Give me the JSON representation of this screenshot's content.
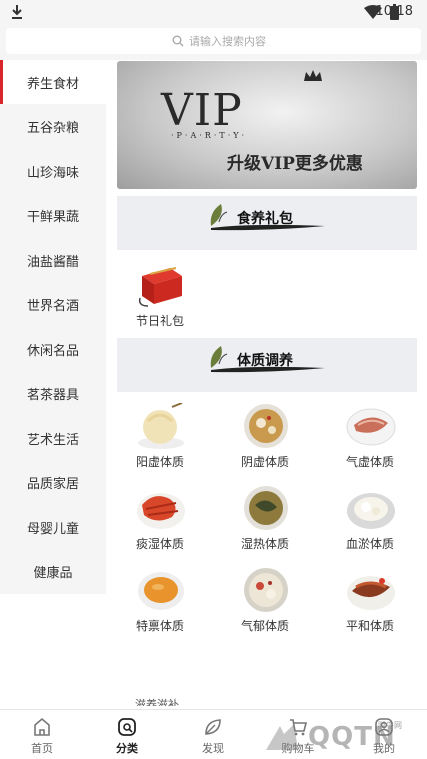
{
  "status_bar": {
    "time": "10:18"
  },
  "search": {
    "placeholder": "请输入搜索内容"
  },
  "sidebar": {
    "items": [
      {
        "label": "养生食材",
        "active": true
      },
      {
        "label": "五谷杂粮"
      },
      {
        "label": "山珍海味"
      },
      {
        "label": "干鲜果蔬"
      },
      {
        "label": "油盐酱醋"
      },
      {
        "label": "世界名酒"
      },
      {
        "label": "休闲名品"
      },
      {
        "label": "茗茶器具"
      },
      {
        "label": "艺术生活"
      },
      {
        "label": "品质家居"
      },
      {
        "label": "母婴儿童"
      },
      {
        "label": "健康品"
      }
    ],
    "accent": "#d8262c"
  },
  "banner": {
    "vip": "VIP",
    "party": "·P·A·R·T·Y·",
    "slogan": "升级VIP更多优惠"
  },
  "sections": [
    {
      "title": "食养礼包",
      "items": [
        {
          "label": "节日礼包",
          "icon": "gift-box-image"
        }
      ]
    },
    {
      "title": "体质调养",
      "items": [
        {
          "label": "阳虚体质",
          "icon": "pear-dessert-image"
        },
        {
          "label": "阴虚体质",
          "icon": "soup-bowl-image"
        },
        {
          "label": "气虚体质",
          "icon": "sliced-meat-image"
        },
        {
          "label": "痰湿体质",
          "icon": "crayfish-image"
        },
        {
          "label": "湿热体质",
          "icon": "herbal-soup-image"
        },
        {
          "label": "血淤体质",
          "icon": "white-fungus-image"
        },
        {
          "label": "特禀体质",
          "icon": "pumpkin-soup-image"
        },
        {
          "label": "气郁体质",
          "icon": "clear-soup-image"
        },
        {
          "label": "平和体质",
          "icon": "braised-fish-image"
        }
      ]
    }
  ],
  "next_section_peek": "滋养滋补",
  "bottom_nav": [
    {
      "label": "首页",
      "icon": "home-icon"
    },
    {
      "label": "分类",
      "icon": "category-icon",
      "active": true
    },
    {
      "label": "发现",
      "icon": "leaf-icon"
    },
    {
      "label": "购物车",
      "icon": "cart-icon"
    },
    {
      "label": "我的",
      "icon": "profile-icon"
    }
  ],
  "watermark": {
    "text": "QQTN",
    "small": "腾牛网"
  }
}
